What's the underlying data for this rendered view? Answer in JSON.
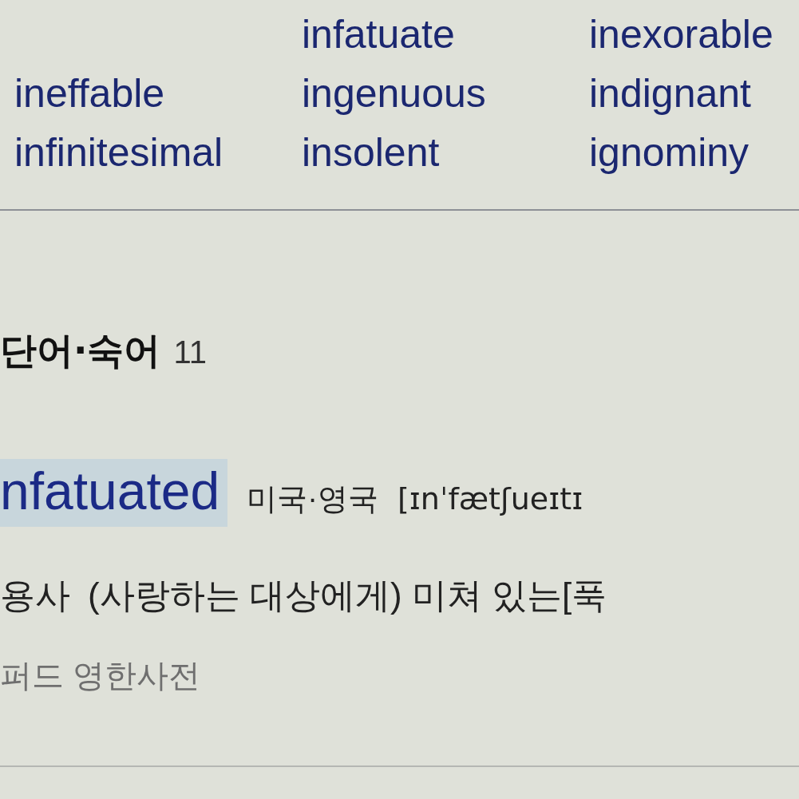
{
  "related_words": {
    "columns": [
      [
        "ineffable",
        "infinitesimal"
      ],
      [
        "infatuate",
        "ingenuous",
        "insolent"
      ],
      [
        "inexorable",
        "indignant",
        "ignominy"
      ]
    ]
  },
  "section": {
    "title": "단어·숙어",
    "count": "11"
  },
  "entry": {
    "headword": "nfatuated",
    "highlighted": true,
    "pronunciation_label": "미국·영국",
    "pronunciation": "[ɪnˈfætʃueɪtɪ",
    "part_of_speech": "용사",
    "definition": "(사랑하는 대상에게) 미쳐 있는[푹",
    "source": "퍼드 영한사전"
  }
}
